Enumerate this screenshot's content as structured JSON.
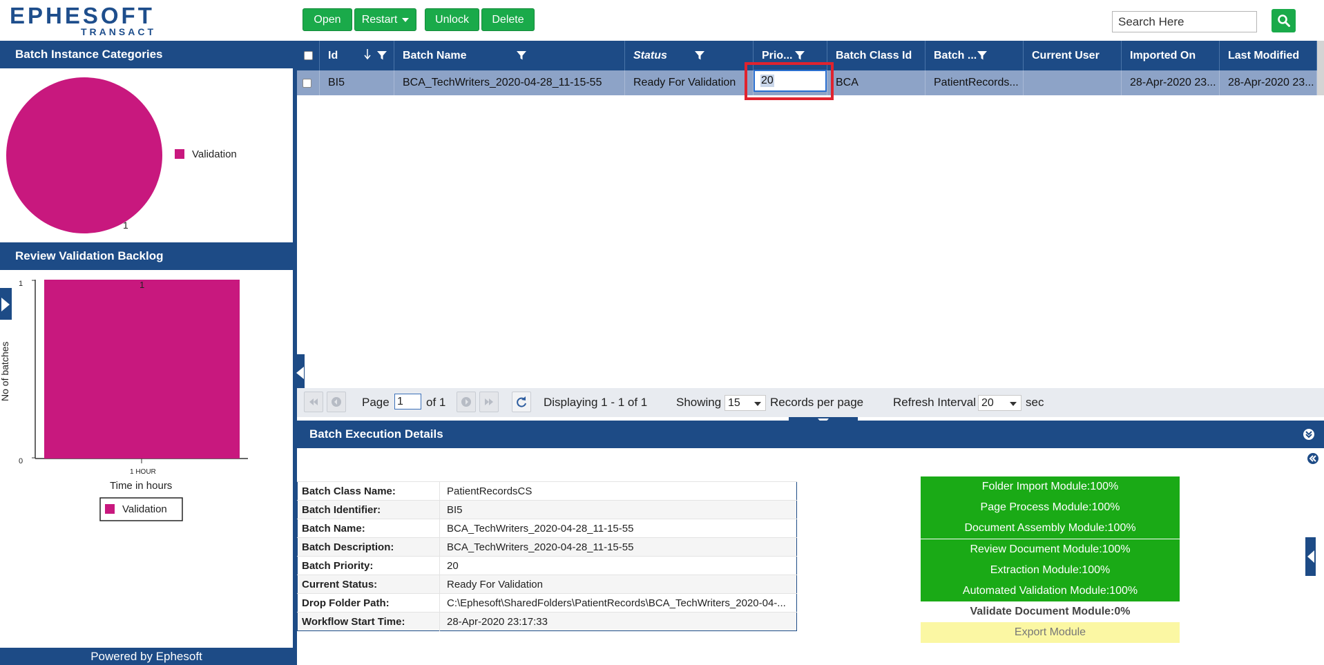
{
  "brand": {
    "name": "EPHESOFT",
    "product": "TRANSACT"
  },
  "toolbar": {
    "open": "Open",
    "restart": "Restart",
    "unlock": "Unlock",
    "delete": "Delete"
  },
  "search": {
    "placeholder": "Search Here"
  },
  "left": {
    "categories_title": "Batch Instance Categories",
    "backlog_title": "Review Validation Backlog",
    "footer": "Powered by Ephesoft"
  },
  "pie": {
    "label": "1",
    "legend": "Validation",
    "color": "#c8187e"
  },
  "backlog_chart": {
    "bar_label": "1",
    "y_ticks": [
      "1",
      "0"
    ],
    "x_tick": "1 HOUR",
    "xlabel": "Time in hours",
    "ylabel": "No of batches",
    "legend": "Validation",
    "color": "#c8187e"
  },
  "chart_data": [
    {
      "type": "pie",
      "title": "Batch Instance Categories",
      "categories": [
        "Validation"
      ],
      "values": [
        1
      ],
      "legend": "right"
    },
    {
      "type": "bar",
      "title": "Review Validation Backlog",
      "categories": [
        "1 HOUR"
      ],
      "series": [
        {
          "name": "Validation",
          "values": [
            1
          ]
        }
      ],
      "xlabel": "Time in hours",
      "ylabel": "No of batches",
      "ylim": [
        0,
        1
      ],
      "legend": "bottom"
    }
  ],
  "grid": {
    "columns": {
      "id": "Id",
      "batch_name": "Batch Name",
      "status": "Status",
      "priority": "Prio...",
      "batch_class_id": "Batch Class Id",
      "batch_desc": "Batch ...",
      "current_user": "Current User",
      "imported_on": "Imported On",
      "last_modified": "Last Modified"
    },
    "row": {
      "id": "BI5",
      "batch_name": "BCA_TechWriters_2020-04-28_11-15-55",
      "status": "Ready For Validation",
      "priority": "20",
      "batch_class_id": "BCA",
      "batch_desc": "PatientRecords...",
      "current_user": "",
      "imported_on": "28-Apr-2020 23...",
      "last_modified": "28-Apr-2020 23..."
    }
  },
  "pager": {
    "page_label": "Page",
    "page_value": "1",
    "of_label": "of 1",
    "displaying": "Displaying 1 - 1 of 1",
    "showing_label": "Showing",
    "showing_value": "15",
    "records_label": "Records per page",
    "refresh_label": "Refresh Interval",
    "refresh_value": "20",
    "sec_label": "sec"
  },
  "details": {
    "title": "Batch Execution Details",
    "rows": [
      {
        "k": "Batch Class Name:",
        "v": "PatientRecordsCS"
      },
      {
        "k": "Batch Identifier:",
        "v": "BI5"
      },
      {
        "k": "Batch Name:",
        "v": "BCA_TechWriters_2020-04-28_11-15-55"
      },
      {
        "k": "Batch Description:",
        "v": "BCA_TechWriters_2020-04-28_11-15-55"
      },
      {
        "k": "Batch Priority:",
        "v": "20"
      },
      {
        "k": "Current Status:",
        "v": "Ready For Validation"
      },
      {
        "k": "Drop Folder Path:",
        "v": "C:\\Ephesoft\\SharedFolders\\PatientRecords\\BCA_TechWriters_2020-04-..."
      },
      {
        "k": "Workflow Start Time:",
        "v": "28-Apr-2020 23:17:33"
      }
    ],
    "modules": [
      "Folder Import Module:100%",
      "Page Process Module:100%",
      "Document Assembly Module:100%",
      "Review Document Module:100%",
      "Extraction Module:100%",
      "Automated Validation Module:100%",
      "Validate Document Module:0%",
      "Export Module"
    ]
  },
  "colors": {
    "header_blue": "#1d4b86",
    "button_green": "#1aaa4a",
    "module_green": "#1aaa16",
    "export_yellow": "#fbf7a3",
    "highlight_red": "#e0232e"
  }
}
